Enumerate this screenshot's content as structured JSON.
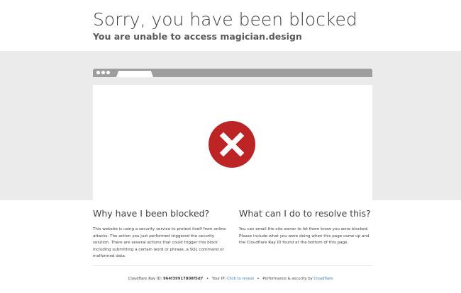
{
  "header": {
    "title": "Sorry, you have been blocked",
    "subtitle": "You are unable to access magician.design"
  },
  "icon": {
    "name": "error-x-icon",
    "color": "#bd2426"
  },
  "left_column": {
    "heading": "Why have I been blocked?",
    "body": "This website is using a security service to protect itself from online attacks. The action you just performed triggered the security solution. There are several actions that could trigger this block including submitting a certain word or phrase, a SQL command or malformed data."
  },
  "right_column": {
    "heading": "What can I do to resolve this?",
    "body": "You can email the site owner to let them know you were blocked. Please include what you were doing when this page came up and the Cloudflare Ray ID found at the bottom of this page."
  },
  "footer": {
    "ray_label": "Cloudflare Ray ID:",
    "ray_id": "964f39917808f5d7",
    "separator": "•",
    "ip_label": "Your IP:",
    "ip_link": "Click to reveal",
    "perf_label": "Performance & security by",
    "perf_link": "Cloudflare"
  },
  "colors": {
    "accent_link": "#2f7bbf",
    "band": "#ebebeb",
    "browser_chrome": "#9e9e9e"
  }
}
